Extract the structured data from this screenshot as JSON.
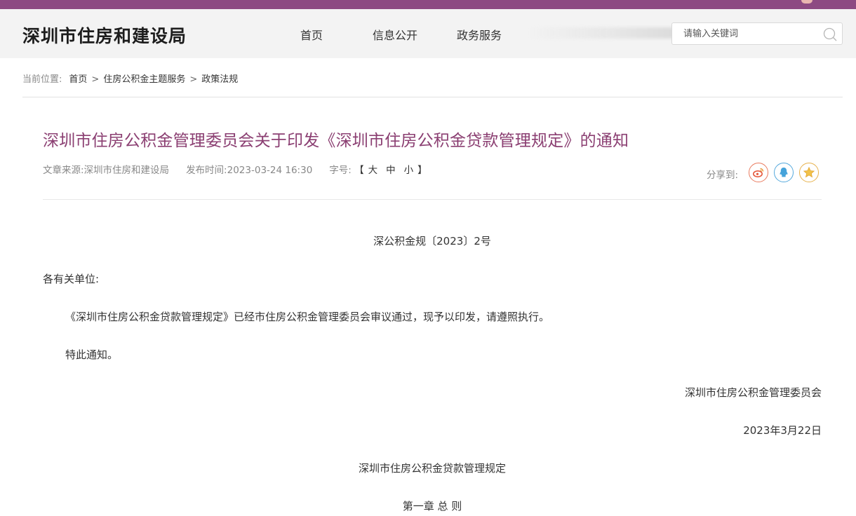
{
  "header": {
    "site_title": "深圳市住房和建设局",
    "nav": [
      "首页",
      "信息公开",
      "政务服务"
    ],
    "search_placeholder": "请输入关键词",
    "brand_color": "#8d4a82"
  },
  "breadcrumb": {
    "label": "当前位置:",
    "items": [
      "首页",
      "住房公积金主题服务",
      "政策法规"
    ],
    "separator": ">"
  },
  "article": {
    "title": "深圳市住房公积金管理委员会关于印发《深圳市住房公积金贷款管理规定》的通知",
    "source_label": "文章来源:",
    "source": "深圳市住房和建设局",
    "time_label": "发布时间:",
    "time": "2023-03-24 16:30",
    "fontsize_label": "字号:",
    "bracket_open": "【",
    "bracket_close": "】",
    "font_sizes": [
      "大",
      "中",
      "小"
    ],
    "share_label": "分享到:",
    "share_icons": [
      "weibo-icon",
      "qq-icon",
      "favorite-star-icon"
    ],
    "title_color": "#8b3f72"
  },
  "content": {
    "doc_number": "深公积金规〔2023〕2号",
    "greeting": "各有关单位:",
    "para1": "《深圳市住房公积金贷款管理规定》已经市住房公积金管理委员会审议通过，现予以印发，请遵照执行。",
    "para2": "特此通知。",
    "signature_org": "深圳市住房公积金管理委员会",
    "signature_date": "2023年3月22日",
    "regulation_title": "深圳市住房公积金贷款管理规定",
    "chapter": "第一章 总 则"
  }
}
